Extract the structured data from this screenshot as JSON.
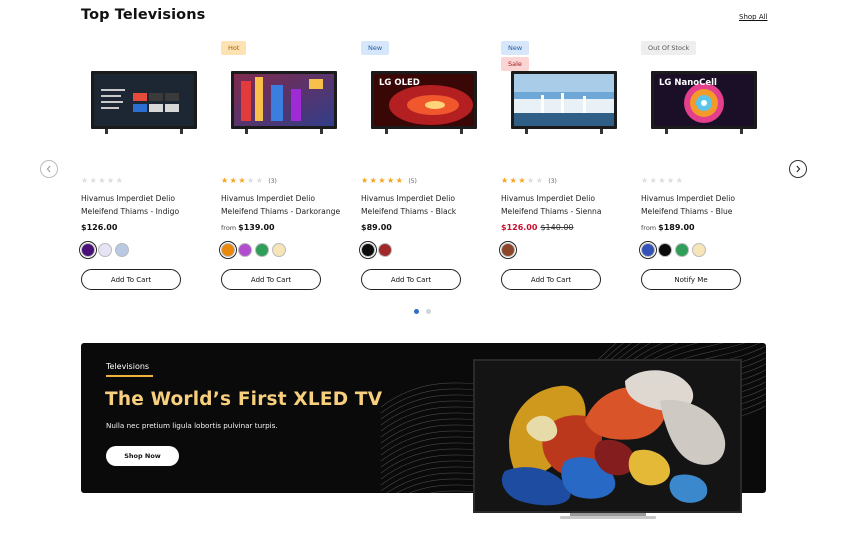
{
  "section": {
    "title": "Top Televisions",
    "shop_all": "Shop All"
  },
  "carousel": {
    "prev_icon": "chevron-left-icon",
    "next_icon": "chevron-right-icon",
    "pages": 2,
    "active_page": 1
  },
  "products": [
    {
      "badges": [],
      "screen_label": "",
      "rating": 0,
      "reviews": "",
      "name_line1": "Hivamus Imperdiet Delio",
      "name_line2": "Meleifend Thiams - Indigo",
      "from": "",
      "price": "$126.00",
      "old_price": "",
      "swatches": [
        "#4b0f7a",
        "#e6e4f4",
        "#b9c8e3"
      ],
      "button": "Add To Cart"
    },
    {
      "badges": [
        {
          "label": "Hot",
          "kind": "hot"
        }
      ],
      "screen_label": "",
      "rating": 3,
      "reviews": "(3)",
      "name_line1": "Hivamus Imperdiet Delio",
      "name_line2": "Meleifend Thiams - Darkorange",
      "from": "from",
      "price": "$139.00",
      "old_price": "",
      "swatches": [
        "#e8890c",
        "#b24dcf",
        "#2e9e58",
        "#f7e4b8"
      ],
      "button": "Add To Cart"
    },
    {
      "badges": [
        {
          "label": "New",
          "kind": "new"
        }
      ],
      "screen_label": "LG OLED",
      "rating": 5,
      "reviews": "(5)",
      "name_line1": "Hivamus Imperdiet Delio",
      "name_line2": "Meleifend Thiams - Black",
      "from": "",
      "price": "$89.00",
      "old_price": "",
      "swatches": [
        "#0b0b0b",
        "#a02a2a"
      ],
      "button": "Add To Cart"
    },
    {
      "badges": [
        {
          "label": "New",
          "kind": "new"
        },
        {
          "label": "Sale",
          "kind": "sale"
        }
      ],
      "screen_label": "",
      "rating": 3,
      "reviews": "(3)",
      "name_line1": "Hivamus Imperdiet Delio",
      "name_line2": "Meleifend Thiams - Sienna",
      "from": "",
      "price": "$126.00",
      "old_price": "$140.00",
      "swatches": [
        "#8c4526"
      ],
      "button": "Add To Cart"
    },
    {
      "badges": [
        {
          "label": "Out Of Stock",
          "kind": "oos"
        }
      ],
      "screen_label": "LG NanoCell",
      "rating": 0,
      "reviews": "",
      "name_line1": "Hivamus Imperdiet Delio",
      "name_line2": "Meleifend Thiams - Blue",
      "from": "from",
      "price": "$189.00",
      "old_price": "",
      "swatches": [
        "#3352b8",
        "#0b0b0b",
        "#2e9e58",
        "#f7e4b8"
      ],
      "button": "Notify Me"
    }
  ],
  "banner": {
    "category": "Televisions",
    "title": "The World’s First XLED TV",
    "subtitle": "Nulla nec pretium ligula lobortis pulvinar turpis.",
    "button": "Shop Now"
  },
  "colors": {
    "accent": "#f0b23d",
    "title_gold": "#f7cf7d",
    "sale_red": "#c8102e",
    "star": "#f4a41c",
    "dot_active": "#2f6fc0"
  }
}
